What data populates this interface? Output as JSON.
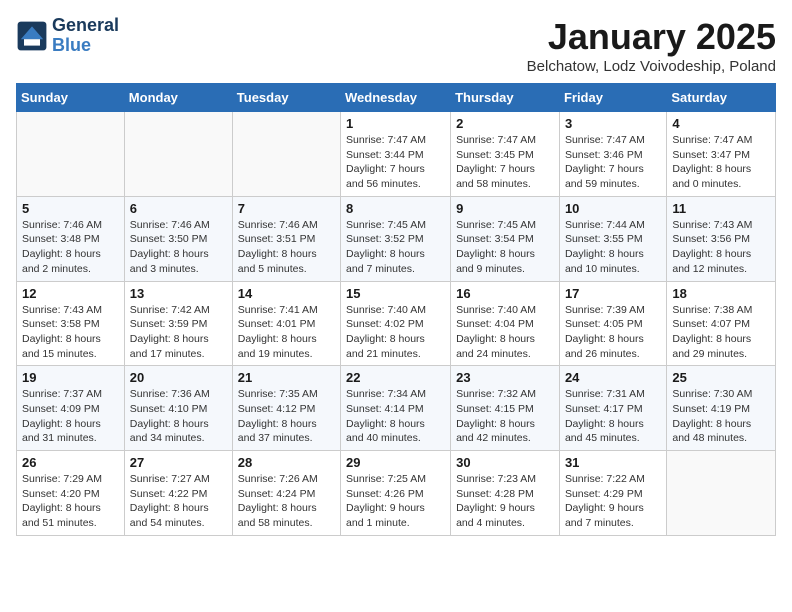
{
  "header": {
    "logo_line1": "General",
    "logo_line2": "Blue",
    "month": "January 2025",
    "location": "Belchatow, Lodz Voivodeship, Poland"
  },
  "weekdays": [
    "Sunday",
    "Monday",
    "Tuesday",
    "Wednesday",
    "Thursday",
    "Friday",
    "Saturday"
  ],
  "weeks": [
    [
      {
        "day": "",
        "info": ""
      },
      {
        "day": "",
        "info": ""
      },
      {
        "day": "",
        "info": ""
      },
      {
        "day": "1",
        "info": "Sunrise: 7:47 AM\nSunset: 3:44 PM\nDaylight: 7 hours and 56 minutes."
      },
      {
        "day": "2",
        "info": "Sunrise: 7:47 AM\nSunset: 3:45 PM\nDaylight: 7 hours and 58 minutes."
      },
      {
        "day": "3",
        "info": "Sunrise: 7:47 AM\nSunset: 3:46 PM\nDaylight: 7 hours and 59 minutes."
      },
      {
        "day": "4",
        "info": "Sunrise: 7:47 AM\nSunset: 3:47 PM\nDaylight: 8 hours and 0 minutes."
      }
    ],
    [
      {
        "day": "5",
        "info": "Sunrise: 7:46 AM\nSunset: 3:48 PM\nDaylight: 8 hours and 2 minutes."
      },
      {
        "day": "6",
        "info": "Sunrise: 7:46 AM\nSunset: 3:50 PM\nDaylight: 8 hours and 3 minutes."
      },
      {
        "day": "7",
        "info": "Sunrise: 7:46 AM\nSunset: 3:51 PM\nDaylight: 8 hours and 5 minutes."
      },
      {
        "day": "8",
        "info": "Sunrise: 7:45 AM\nSunset: 3:52 PM\nDaylight: 8 hours and 7 minutes."
      },
      {
        "day": "9",
        "info": "Sunrise: 7:45 AM\nSunset: 3:54 PM\nDaylight: 8 hours and 9 minutes."
      },
      {
        "day": "10",
        "info": "Sunrise: 7:44 AM\nSunset: 3:55 PM\nDaylight: 8 hours and 10 minutes."
      },
      {
        "day": "11",
        "info": "Sunrise: 7:43 AM\nSunset: 3:56 PM\nDaylight: 8 hours and 12 minutes."
      }
    ],
    [
      {
        "day": "12",
        "info": "Sunrise: 7:43 AM\nSunset: 3:58 PM\nDaylight: 8 hours and 15 minutes."
      },
      {
        "day": "13",
        "info": "Sunrise: 7:42 AM\nSunset: 3:59 PM\nDaylight: 8 hours and 17 minutes."
      },
      {
        "day": "14",
        "info": "Sunrise: 7:41 AM\nSunset: 4:01 PM\nDaylight: 8 hours and 19 minutes."
      },
      {
        "day": "15",
        "info": "Sunrise: 7:40 AM\nSunset: 4:02 PM\nDaylight: 8 hours and 21 minutes."
      },
      {
        "day": "16",
        "info": "Sunrise: 7:40 AM\nSunset: 4:04 PM\nDaylight: 8 hours and 24 minutes."
      },
      {
        "day": "17",
        "info": "Sunrise: 7:39 AM\nSunset: 4:05 PM\nDaylight: 8 hours and 26 minutes."
      },
      {
        "day": "18",
        "info": "Sunrise: 7:38 AM\nSunset: 4:07 PM\nDaylight: 8 hours and 29 minutes."
      }
    ],
    [
      {
        "day": "19",
        "info": "Sunrise: 7:37 AM\nSunset: 4:09 PM\nDaylight: 8 hours and 31 minutes."
      },
      {
        "day": "20",
        "info": "Sunrise: 7:36 AM\nSunset: 4:10 PM\nDaylight: 8 hours and 34 minutes."
      },
      {
        "day": "21",
        "info": "Sunrise: 7:35 AM\nSunset: 4:12 PM\nDaylight: 8 hours and 37 minutes."
      },
      {
        "day": "22",
        "info": "Sunrise: 7:34 AM\nSunset: 4:14 PM\nDaylight: 8 hours and 40 minutes."
      },
      {
        "day": "23",
        "info": "Sunrise: 7:32 AM\nSunset: 4:15 PM\nDaylight: 8 hours and 42 minutes."
      },
      {
        "day": "24",
        "info": "Sunrise: 7:31 AM\nSunset: 4:17 PM\nDaylight: 8 hours and 45 minutes."
      },
      {
        "day": "25",
        "info": "Sunrise: 7:30 AM\nSunset: 4:19 PM\nDaylight: 8 hours and 48 minutes."
      }
    ],
    [
      {
        "day": "26",
        "info": "Sunrise: 7:29 AM\nSunset: 4:20 PM\nDaylight: 8 hours and 51 minutes."
      },
      {
        "day": "27",
        "info": "Sunrise: 7:27 AM\nSunset: 4:22 PM\nDaylight: 8 hours and 54 minutes."
      },
      {
        "day": "28",
        "info": "Sunrise: 7:26 AM\nSunset: 4:24 PM\nDaylight: 8 hours and 58 minutes."
      },
      {
        "day": "29",
        "info": "Sunrise: 7:25 AM\nSunset: 4:26 PM\nDaylight: 9 hours and 1 minute."
      },
      {
        "day": "30",
        "info": "Sunrise: 7:23 AM\nSunset: 4:28 PM\nDaylight: 9 hours and 4 minutes."
      },
      {
        "day": "31",
        "info": "Sunrise: 7:22 AM\nSunset: 4:29 PM\nDaylight: 9 hours and 7 minutes."
      },
      {
        "day": "",
        "info": ""
      }
    ]
  ]
}
